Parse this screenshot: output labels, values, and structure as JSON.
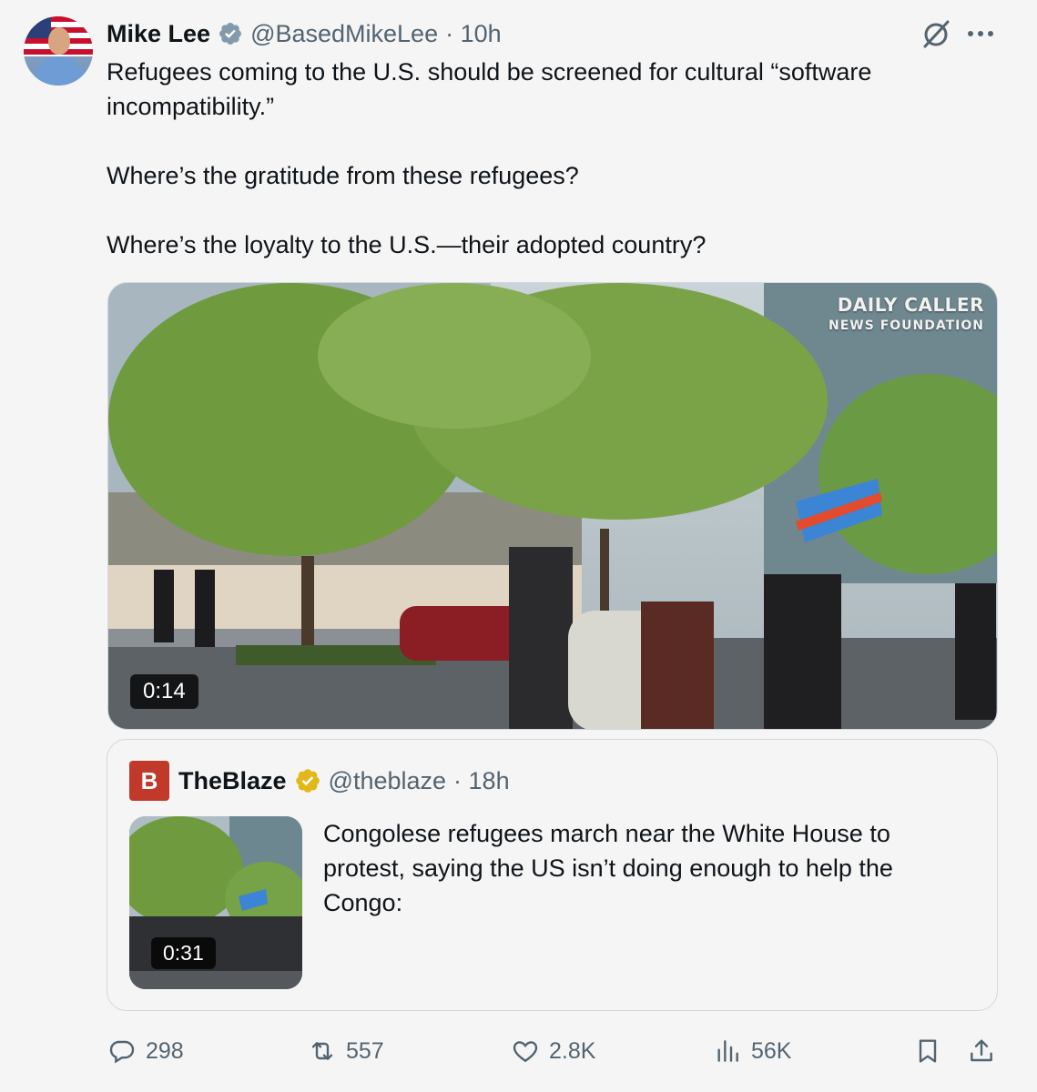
{
  "author": {
    "name": "Mike Lee",
    "handle": "@BasedMikeLee",
    "time": "· 10h"
  },
  "tweet": {
    "paragraphs": [
      "Refugees coming to the U.S. should be screened for cultural “software incompatibility.”",
      "Where’s the gratitude from these refugees?",
      "Where’s the loyalty to the U.S.—their adopted country?"
    ]
  },
  "media": {
    "duration": "0:14",
    "watermark_line1": "DAILY CALLER",
    "watermark_line2": "NEWS FOUNDATION"
  },
  "quote": {
    "logo_letter": "B",
    "name": "TheBlaze",
    "handle": "@theblaze",
    "time": "· 18h",
    "text": "Congolese refugees march near the White House to protest, saying the US isn’t doing enough to help the Congo:",
    "thumb_duration": "0:31"
  },
  "actions": {
    "replies": "298",
    "reposts": "557",
    "likes": "2.8K",
    "views": "56K"
  },
  "icons": {
    "verified_author": "verified-badge-blue-icon",
    "verified_quote": "verified-badge-gold-icon",
    "grok": "grok-icon",
    "more": "more-icon",
    "reply": "reply-icon",
    "repost": "repost-icon",
    "like": "heart-icon",
    "views": "views-icon",
    "bookmark": "bookmark-icon",
    "share": "share-icon"
  },
  "colors": {
    "background": "#f5f5f5",
    "text": "#0f1419",
    "secondary_text": "#536471",
    "verified_blue": "#829aab",
    "verified_gold": "#e2b719",
    "blaze_red": "#c0392b"
  }
}
